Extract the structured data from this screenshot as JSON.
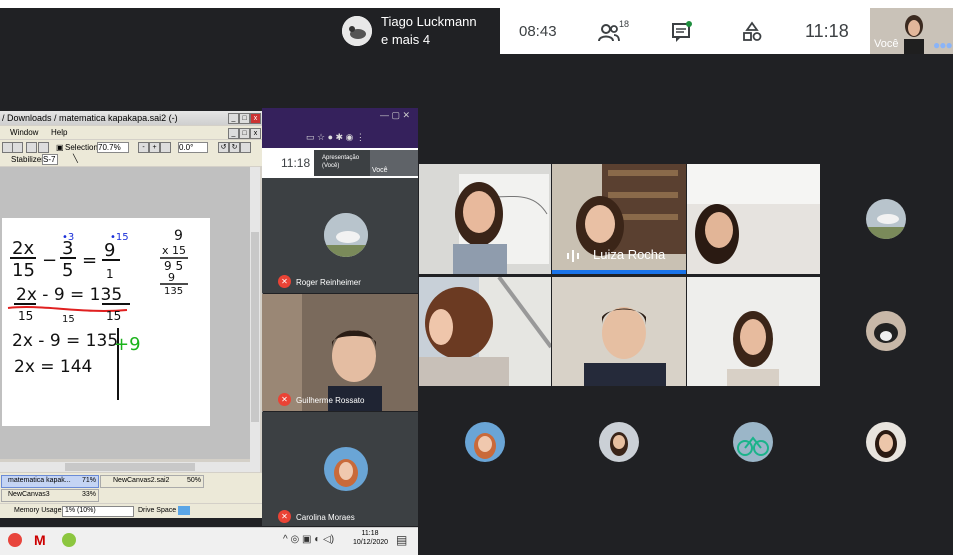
{
  "meet_bar": {
    "presenter_name": "Tiago Luckmann",
    "presenter_more": "e mais 4",
    "time_elapsed": "08:43",
    "participants_count": "18",
    "clock": "11:18",
    "self_label": "Você"
  },
  "sai_window": {
    "title": "/ Downloads / matematica kapakapa.sai2 (-)",
    "menu": [
      "Window",
      "Help"
    ],
    "selection_label": "Selection",
    "zoom": "70.7%",
    "angle": "0.0°",
    "stabilizer_label": "Stabilizer",
    "stabilizer_value": "S-7",
    "tabs": [
      {
        "name": "matematica kapak...",
        "pct": "71%"
      },
      {
        "name": "NewCanvas2.sai2",
        "pct": "50%"
      },
      {
        "name": "NewCanvas3",
        "pct": "33%"
      }
    ],
    "memory_label": "Memory Usage",
    "memory_value": "1% (10%)",
    "drive_label": "Drive Space"
  },
  "math": {
    "line1_lhs_num": "2x",
    "line1_lhs_den": "15",
    "line1_mid_num": "3",
    "line1_mid_den": "5",
    "line1_rhs_num": "9",
    "line1_rhs_den": "1",
    "mark_3": "•3",
    "mark_15": "•15",
    "side_calc": [
      "9",
      "x 15",
      "9 5",
      "9",
      "135"
    ],
    "line2": "2x - 9 = 135",
    "line2_den_left": "15",
    "line2_den_right": "15",
    "line3": "2x - 9 = 135",
    "line3_mark": "+9",
    "line4": "2x = 144"
  },
  "mini_meet": {
    "time": "11:18",
    "present_label": "Apresentação (Você)",
    "you_label": "Você",
    "participants": [
      "Roger Reinheimer",
      "Guilherme Rossato",
      "Carolina Moraes"
    ]
  },
  "main_grid": {
    "active_speaker": "Luiza Rocha"
  },
  "taskbar": {
    "time": "11:18",
    "date": "10/12/2020"
  },
  "colors": {
    "meet_dark": "#202124",
    "tile": "#3c4043",
    "mic_off": "#ea4335",
    "speaking": "#1a73e8",
    "ink_blue": "#1a2fd9",
    "ink_green": "#1bb31b",
    "ink_red": "#e02020"
  }
}
